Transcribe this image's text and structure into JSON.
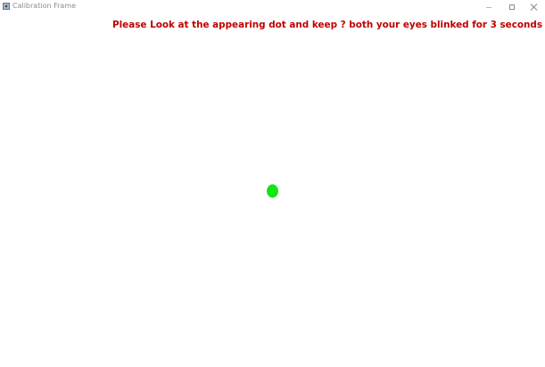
{
  "window": {
    "title": "Calibration Frame",
    "controls": {
      "minimize_icon": "minimize-icon",
      "maximize_icon": "maximize-icon",
      "close_icon": "close-icon"
    }
  },
  "instruction": {
    "text": "Please Look at the appearing dot and keep ? both your eyes blinked for 3 seconds",
    "color": "#c00000"
  },
  "calibration_dot": {
    "color": "#12e612",
    "icon": "green-dot"
  }
}
